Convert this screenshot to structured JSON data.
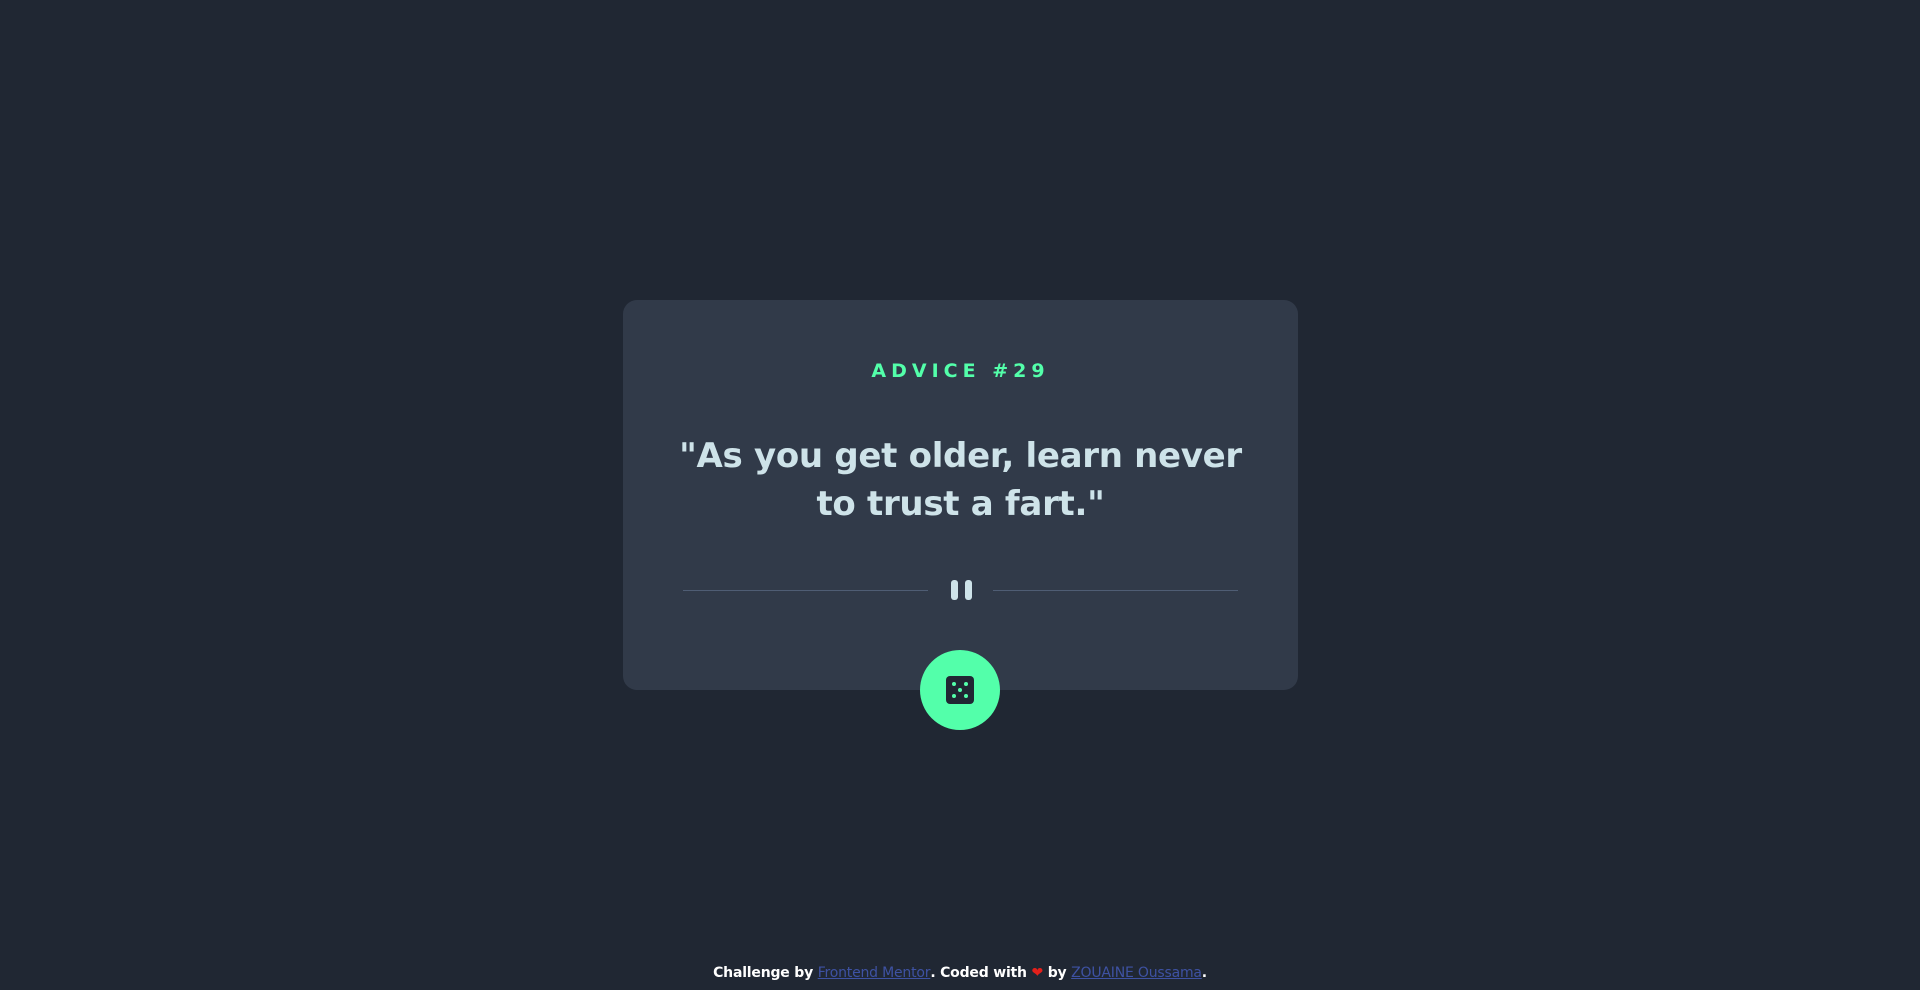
{
  "card": {
    "advice_label": "ADVICE #29",
    "quote": "\"As you get older, learn never to trust a fart.\""
  },
  "divider": {
    "icon": "pause-icon"
  },
  "button": {
    "icon": "dice-icon"
  },
  "footer": {
    "prefix": "Challenge by",
    "link1": "Frontend Mentor",
    "middle": ". Coded with",
    "heart_icon": "heart-icon",
    "by": "by",
    "link2": "ZOUAINE Oussama",
    "suffix": "."
  },
  "colors": {
    "background": "#202733",
    "card": "#313A49",
    "accent": "#53FFAA",
    "text": "#CEE3E9",
    "link": "#3E52A3",
    "heart": "#E3201B"
  }
}
